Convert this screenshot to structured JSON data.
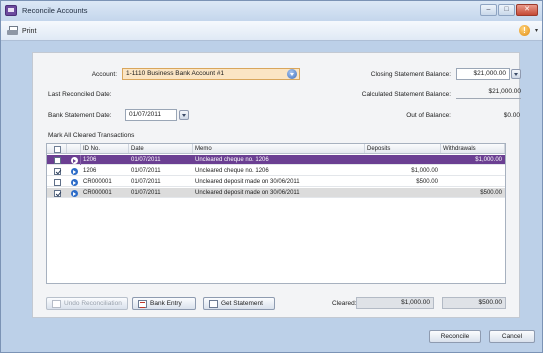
{
  "window": {
    "title": "Reconcile Accounts"
  },
  "toolbar": {
    "print_label": "Print"
  },
  "form": {
    "account_label": "Account:",
    "account_value": "1-1110 Business Bank Account #1",
    "last_reconciled_label": "Last Reconciled Date:",
    "bank_statement_label": "Bank Statement Date:",
    "bank_statement_value": "01/07/2011",
    "closing_label": "Closing Statement Balance:",
    "closing_value": "$21,000.00",
    "calculated_label": "Calculated Statement Balance:",
    "calculated_value": "$21,000.00",
    "out_of_balance_label": "Out of Balance:",
    "out_of_balance_value": "$0.00",
    "mark_all_label": "Mark All Cleared Transactions"
  },
  "grid": {
    "columns": [
      "ID No.",
      "Date",
      "Memo",
      "Deposits",
      "Withdrawals"
    ],
    "rows": [
      {
        "checked": false,
        "id": "1206",
        "date": "01/07/2011",
        "memo": "Uncleared cheque no. 1206",
        "deposits": "",
        "withdrawals": "$1,000.00"
      },
      {
        "checked": true,
        "id": "1206",
        "date": "01/07/2011",
        "memo": "Uncleared cheque no. 1206",
        "deposits": "$1,000.00",
        "withdrawals": ""
      },
      {
        "checked": false,
        "id": "CR000001",
        "date": "01/07/2011",
        "memo": "Uncleared deposit made on 30/06/2011",
        "deposits": "$500.00",
        "withdrawals": ""
      },
      {
        "checked": true,
        "id": "CR000001",
        "date": "01/07/2011",
        "memo": "Uncleared deposit made on 30/06/2011",
        "deposits": "",
        "withdrawals": "$500.00"
      }
    ]
  },
  "footer": {
    "undo_label": "Undo Reconciliation",
    "bank_entry_label": "Bank Entry",
    "get_statement_label": "Get Statement",
    "cleared_label": "Cleared:",
    "cleared_deposits": "$1,000.00",
    "cleared_withdrawals": "$500.00",
    "reconcile_label": "Reconcile",
    "cancel_label": "Cancel"
  },
  "colors": {
    "selected_row": "#6b3f92",
    "account_field": "#fbe5c4"
  },
  "icons": [
    "reconcile-app-icon",
    "printer-icon",
    "help-icon",
    "dropdown-icon",
    "transaction-arrow-icon",
    "checkbox-icon"
  ]
}
